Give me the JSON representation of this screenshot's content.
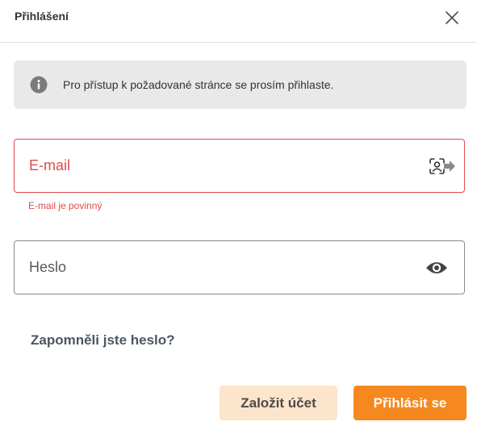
{
  "dialog": {
    "title": "Přihlášení",
    "close_icon": "close-icon"
  },
  "info": {
    "icon": "info-icon",
    "message": "Pro přístup k požadované stránce se prosím přihlaste."
  },
  "email": {
    "placeholder": "E-mail",
    "value": "",
    "icon": "face-scan-icon",
    "error": "E-mail je povinný"
  },
  "password": {
    "placeholder": "Heslo",
    "value": "",
    "icon": "eye-icon"
  },
  "forgot_password": "Zapomněli jste heslo?",
  "buttons": {
    "register": "Založit účet",
    "login": "Přihlásit se"
  },
  "colors": {
    "accent": "#f5891f",
    "accent_light": "#fde5cc",
    "error": "#e04b4b",
    "info_background": "#e9e9e9"
  }
}
